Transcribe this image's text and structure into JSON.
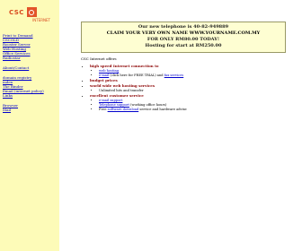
{
  "logo": {
    "text": "CSC",
    "subtext": "INTERNET"
  },
  "nav": {
    "group1": [
      "Print to Demand",
      "CSCOLD",
      "Rooster Server",
      "Web Hosting",
      "Office Services",
      "Radiostar"
    ],
    "group2": [
      "About/Contact"
    ],
    "group3": [
      "domain registry",
      "index",
      "The Binder",
      "Email (internet policy)",
      "Links"
    ],
    "group4": [
      "Browser",
      "Mail"
    ]
  },
  "notice": {
    "phone": "Our new telephone is 40-82-949889",
    "claim": "CLAIM YOUR VERY OWN NAME WWW.YOURNAME.COM.MY",
    "price1": "FOR ONLY RM80.00 TODAY!",
    "price2": "Hosting for start at RM250.00"
  },
  "intro": "CSC Internet offers",
  "services": [
    {
      "head": "high speed Internet connection to",
      "items": [
        {
          "link": "web hosting",
          "after": ""
        },
        {
          "pre": "",
          "link": "e-mail",
          "after": " (click here for FREE TRIAL) and ",
          "link2": "fax services"
        }
      ]
    },
    {
      "head": "budget prices",
      "items": []
    },
    {
      "head": "world wide web hosting services",
      "items": [
        {
          "pre": "Unlimited hits and transfer"
        }
      ]
    },
    {
      "head": "excellent customer service",
      "items": [
        {
          "link": "e-mail support"
        },
        {
          "link": "Telephone support",
          "after": " (working office hours)"
        },
        {
          "pre": "Free ",
          "link": "software download",
          "after": " service and hardware advise"
        }
      ]
    }
  ]
}
